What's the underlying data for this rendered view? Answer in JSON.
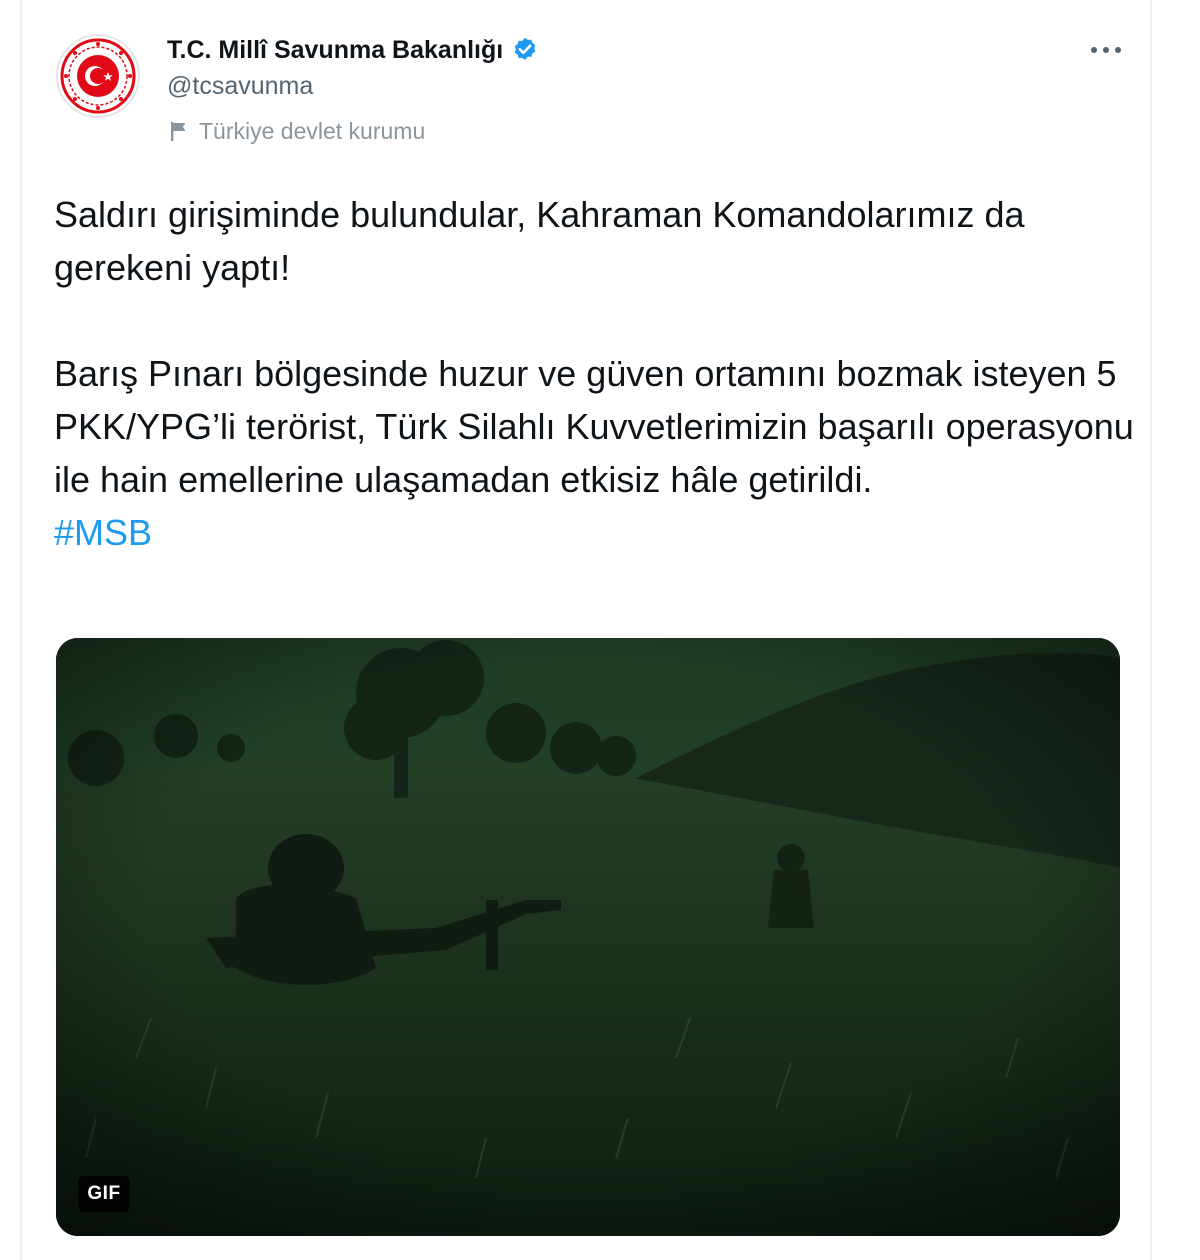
{
  "tweet": {
    "author": {
      "display_name": "T.C. Millî Savunma Bakanlığı",
      "verified_icon": "verified-badge-icon",
      "handle": "@tcsavunma",
      "account_label": "Türkiye devlet kurumu",
      "label_icon": "flag-icon",
      "avatar_icon": "ministry-emblem-icon"
    },
    "text": {
      "paragraph1": "Saldırı girişiminde bulundular, Kahraman Komandolarımız da gerekeni yaptı!",
      "paragraph2": "Barış Pınarı bölgesinde huzur ve güven ortamını bozmak isteyen 5 PKK/YPG’li terörist, Türk Silahlı Kuvvetlerimizin başarılı operasyonu ile hain emellerine ulaşamadan etkisiz hâle getirildi.",
      "hashtag": "#MSB"
    },
    "media": {
      "type_badge": "GIF",
      "description_icon": "night-vision-video-thumbnail"
    },
    "menu_icon": "more-options-icon"
  },
  "colors": {
    "text_primary": "#0f1419",
    "text_secondary": "#536471",
    "link": "#1d9bf0",
    "verified": "#1d9bf0",
    "emblem_red": "#e30a17"
  }
}
